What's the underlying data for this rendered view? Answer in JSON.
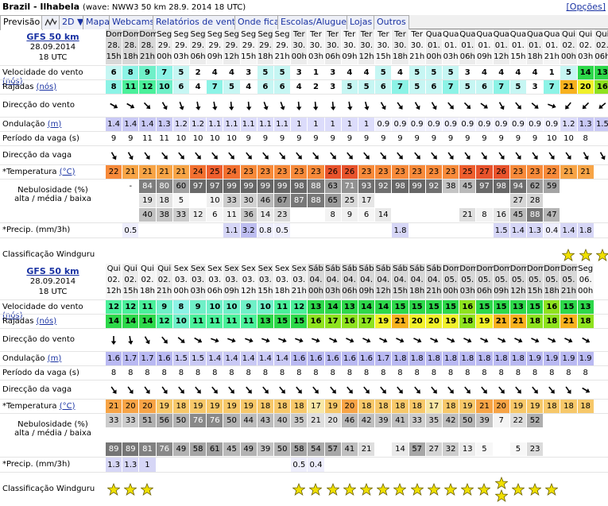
{
  "header": {
    "title": "Brazil - Ilhabela",
    "wave": "(wave: NWW3 50 km 28.9. 2014 18 UTC)",
    "options": "[Opções]"
  },
  "tabs": [
    {
      "label": "Previsão",
      "active": true
    },
    {
      "label": "chart-icon",
      "icon": true
    },
    {
      "label": "2D ▼"
    },
    {
      "label": "Mapa"
    },
    {
      "label": "Webcams"
    },
    {
      "label": "Relatórios de vento"
    },
    {
      "label": "Onde ficar"
    },
    {
      "label": "Escolas/Aluguer"
    },
    {
      "label": "Lojas"
    },
    {
      "label": "Outros"
    }
  ],
  "labels": {
    "wind": "Velocidade do vento",
    "wind_unit": "(nós)",
    "gusts": "Rajadas",
    "gusts_unit": "(nós)",
    "wind_dir": "Direcção do vento",
    "swell": "Ondulação",
    "swell_unit": "(m)",
    "period": "Período da vaga (s)",
    "wave_dir": "Direcção da vaga",
    "temp": "*Temperatura",
    "temp_unit": "(°C)",
    "cloud1": "Nebulosidade (%)",
    "cloud2": "alta / média / baixa",
    "precip": "*Precip. (mm/3h)",
    "rating": "Classificação Windguru"
  },
  "sections": [
    {
      "model": "GFS 50 km",
      "init_date": "28.09.2014",
      "init_time": "18 UTC",
      "days": [
        "Dom",
        "Dom",
        "Dom",
        "Seg",
        "Seg",
        "Seg",
        "Seg",
        "Seg",
        "Seg",
        "Seg",
        "Seg",
        "Ter",
        "Ter",
        "Ter",
        "Ter",
        "Ter",
        "Ter",
        "Ter",
        "Ter",
        "Qua",
        "Qua",
        "Qua",
        "Qua",
        "Qua",
        "Qua",
        "Qua",
        "Qua",
        "Qui",
        "Qui",
        "Qui"
      ],
      "dates": [
        "28.",
        "28.",
        "28.",
        "29.",
        "29.",
        "29.",
        "29.",
        "29.",
        "29.",
        "29.",
        "29.",
        "30.",
        "30.",
        "30.",
        "30.",
        "30.",
        "30.",
        "30.",
        "30.",
        "01.",
        "01.",
        "01.",
        "01.",
        "01.",
        "01.",
        "01.",
        "01.",
        "02.",
        "02.",
        "02."
      ],
      "hours": [
        "15h",
        "18h",
        "21h",
        "00h",
        "03h",
        "06h",
        "09h",
        "12h",
        "15h",
        "18h",
        "21h",
        "00h",
        "03h",
        "06h",
        "09h",
        "12h",
        "15h",
        "18h",
        "21h",
        "00h",
        "03h",
        "06h",
        "09h",
        "12h",
        "15h",
        "18h",
        "21h",
        "00h",
        "03h",
        "06h"
      ],
      "wind": [
        6,
        8,
        9,
        7,
        5,
        2,
        4,
        4,
        3,
        5,
        5,
        3,
        1,
        3,
        4,
        4,
        5,
        4,
        5,
        5,
        5,
        3,
        4,
        4,
        4,
        4,
        1,
        5,
        14,
        13
      ],
      "gusts": [
        8,
        11,
        12,
        10,
        6,
        4,
        7,
        5,
        4,
        6,
        6,
        4,
        2,
        3,
        5,
        5,
        6,
        7,
        5,
        6,
        7,
        5,
        6,
        7,
        5,
        3,
        7,
        21,
        20,
        16
      ],
      "wind_dir": [
        120,
        120,
        135,
        150,
        160,
        170,
        170,
        175,
        175,
        160,
        160,
        175,
        175,
        175,
        170,
        165,
        150,
        145,
        150,
        150,
        140,
        135,
        125,
        150,
        140,
        130,
        110,
        220,
        225,
        230
      ],
      "swell": [
        "1.4",
        "1.4",
        "1.4",
        "1.3",
        "1.2",
        "1.2",
        "1.1",
        "1.1",
        "1.1",
        "1.1",
        "1.1",
        "1",
        "1",
        "1",
        "1",
        "1",
        "0.9",
        "0.9",
        "0.9",
        "0.9",
        "0.9",
        "0.9",
        "0.9",
        "0.9",
        "0.9",
        "0.9",
        "0.9",
        "1.2",
        "1.3",
        "1.5"
      ],
      "period": [
        "9",
        "9",
        "11",
        "11",
        "10",
        "10",
        "10",
        "10",
        "9",
        "9",
        "9",
        "9",
        "9",
        "9",
        "9",
        "9",
        "9",
        "9",
        "9",
        "9",
        "9",
        "9",
        "9",
        "9",
        "9",
        "9",
        "10",
        "10",
        "8"
      ],
      "wave_dir": [
        150,
        150,
        145,
        140,
        140,
        140,
        140,
        140,
        140,
        140,
        140,
        140,
        140,
        140,
        140,
        140,
        140,
        140,
        140,
        140,
        145,
        145,
        145,
        145,
        145,
        145,
        145,
        145,
        150,
        150
      ],
      "temp": [
        22,
        21,
        21,
        21,
        21,
        24,
        25,
        24,
        23,
        23,
        23,
        23,
        23,
        26,
        26,
        23,
        23,
        23,
        23,
        23,
        23,
        25,
        27,
        26,
        23,
        23,
        22,
        21,
        21
      ],
      "cloud_high": [
        "",
        "-",
        "84",
        "80",
        "60",
        "97",
        "97",
        "99",
        "99",
        "99",
        "99",
        "98",
        "88",
        "63",
        "71",
        "93",
        "92",
        "98",
        "99",
        "92",
        "38",
        "45",
        "97",
        "98",
        "94",
        "62",
        "59"
      ],
      "cloud_mid": [
        "",
        "",
        "19",
        "18",
        "5",
        "",
        "10",
        "33",
        "30",
        "46",
        "67",
        "87",
        "88",
        "65",
        "25",
        "17",
        "",
        "",
        "",
        "",
        "",
        "",
        "",
        "",
        "27",
        "28",
        ""
      ],
      "cloud_low": [
        "",
        "",
        "40",
        "38",
        "33",
        "12",
        "6",
        "11",
        "36",
        "14",
        "23",
        "",
        "",
        "8",
        "9",
        "6",
        "14",
        "",
        "",
        "",
        "",
        "21",
        "8",
        "16",
        "45",
        "88",
        "47"
      ],
      "precip": [
        "",
        "0.5",
        "",
        "",
        "",
        "",
        "",
        "1.1",
        "3.2",
        "0.8",
        "0.5",
        "",
        "",
        "",
        "",
        "",
        "",
        "1.8",
        "",
        "",
        "",
        "",
        "",
        "1.5",
        "1.4",
        "1.3",
        "0.4",
        "1.4",
        "1.8"
      ],
      "rating": [
        0,
        0,
        0,
        0,
        0,
        0,
        0,
        0,
        0,
        0,
        0,
        0,
        0,
        0,
        0,
        0,
        0,
        0,
        0,
        0,
        0,
        0,
        0,
        0,
        0,
        0,
        0,
        1,
        1,
        1
      ]
    },
    {
      "model": "GFS 50 km",
      "init_date": "28.09.2014",
      "init_time": "18 UTC",
      "days": [
        "Qui",
        "Qui",
        "Qui",
        "Qui",
        "Sex",
        "Sex",
        "Sex",
        "Sex",
        "Sex",
        "Sex",
        "Sex",
        "Sex",
        "Sáb",
        "Sáb",
        "Sáb",
        "Sáb",
        "Sáb",
        "Sáb",
        "Sáb",
        "Sáb",
        "Dom",
        "Dom",
        "Dom",
        "Dom",
        "Dom",
        "Dom",
        "Dom",
        "Dom",
        "Seg"
      ],
      "dates": [
        "02.",
        "02.",
        "02.",
        "02.",
        "03.",
        "03.",
        "03.",
        "03.",
        "03.",
        "03.",
        "03.",
        "03.",
        "04.",
        "04.",
        "04.",
        "04.",
        "04.",
        "04.",
        "04.",
        "04.",
        "05.",
        "05.",
        "05.",
        "05.",
        "05.",
        "05.",
        "05.",
        "05.",
        "06."
      ],
      "hours": [
        "12h",
        "15h",
        "18h",
        "21h",
        "00h",
        "03h",
        "06h",
        "09h",
        "12h",
        "15h",
        "18h",
        "21h",
        "00h",
        "03h",
        "06h",
        "09h",
        "12h",
        "15h",
        "18h",
        "21h",
        "00h",
        "03h",
        "06h",
        "09h",
        "12h",
        "15h",
        "18h",
        "21h",
        "00h"
      ],
      "wind": [
        12,
        12,
        11,
        9,
        8,
        9,
        10,
        10,
        9,
        10,
        11,
        12,
        13,
        14,
        13,
        14,
        14,
        15,
        15,
        15,
        15,
        16,
        15,
        15,
        13,
        15,
        16,
        15,
        13
      ],
      "gusts": [
        14,
        14,
        14,
        12,
        10,
        11,
        11,
        11,
        11,
        13,
        15,
        15,
        16,
        17,
        16,
        17,
        19,
        21,
        20,
        20,
        19,
        18,
        19,
        21,
        21,
        18,
        18,
        21,
        18
      ],
      "wind_dir": [
        180,
        170,
        150,
        140,
        130,
        120,
        110,
        110,
        110,
        110,
        110,
        110,
        110,
        115,
        115,
        115,
        115,
        115,
        115,
        115,
        115,
        115,
        115,
        115,
        115,
        115,
        115,
        115,
        120
      ],
      "swell": [
        "1.6",
        "1.7",
        "1.7",
        "1.6",
        "1.5",
        "1.5",
        "1.4",
        "1.4",
        "1.4",
        "1.4",
        "1.4",
        "1.6",
        "1.6",
        "1.6",
        "1.6",
        "1.6",
        "1.7",
        "1.8",
        "1.8",
        "1.8",
        "1.8",
        "1.8",
        "1.8",
        "1.8",
        "1.8",
        "1.9",
        "1.9",
        "1.9",
        "1.9"
      ],
      "period": [
        "8",
        "8",
        "8",
        "8",
        "8",
        "8",
        "8",
        "8",
        "8",
        "8",
        "8",
        "8",
        "8",
        "8",
        "8",
        "8",
        "8",
        "8",
        "8",
        "8",
        "8",
        "8",
        "8",
        "8",
        "8",
        "8",
        "8",
        "8",
        "8"
      ],
      "wave_dir": [
        145,
        145,
        145,
        145,
        140,
        140,
        140,
        140,
        140,
        140,
        140,
        140,
        140,
        140,
        140,
        140,
        140,
        140,
        140,
        140,
        140,
        140,
        140,
        140,
        140,
        140,
        140,
        145,
        120
      ],
      "temp": [
        21,
        20,
        20,
        19,
        18,
        19,
        19,
        19,
        19,
        18,
        18,
        18,
        17,
        19,
        20,
        18,
        18,
        18,
        18,
        17,
        18,
        19,
        21,
        20,
        19,
        19,
        18,
        18,
        18
      ],
      "cloud_high": [
        "33",
        "33",
        "51",
        "56",
        "50",
        "76",
        "76",
        "50",
        "44",
        "43",
        "40",
        "35",
        "21",
        "20",
        "46",
        "42",
        "39",
        "41",
        "33",
        "35",
        "42",
        "50",
        "39",
        "7",
        "22",
        "52",
        "",
        "",
        ""
      ],
      "cloud_mid": [
        "",
        "",
        "",
        "",
        "",
        "",
        "",
        "",
        "",
        "",
        "",
        "",
        "",
        "",
        "",
        "",
        "",
        "",
        "",
        "",
        "",
        "",
        "",
        "",
        "",
        "",
        "",
        "",
        ""
      ],
      "cloud_low": [
        "89",
        "89",
        "81",
        "76",
        "49",
        "58",
        "61",
        "45",
        "49",
        "39",
        "50",
        "58",
        "54",
        "57",
        "41",
        "21",
        "",
        "14",
        "57",
        "27",
        "32",
        "13",
        "5",
        "",
        "5",
        "23",
        "",
        "",
        ""
      ],
      "precip": [
        "1.3",
        "1.3",
        "1",
        "",
        "",
        "",
        "",
        "",
        "",
        "",
        "",
        "0.5",
        "0.4",
        "",
        "",
        "",
        "",
        "",
        "",
        "",
        "",
        "",
        "",
        "",
        "",
        "",
        "",
        "",
        ""
      ],
      "rating": [
        1,
        1,
        1,
        0,
        0,
        0,
        0,
        0,
        0,
        0,
        0,
        1,
        1,
        1,
        1,
        1,
        1,
        1,
        1,
        1,
        1,
        1,
        1,
        2,
        1,
        1,
        1,
        0,
        0
      ]
    }
  ]
}
